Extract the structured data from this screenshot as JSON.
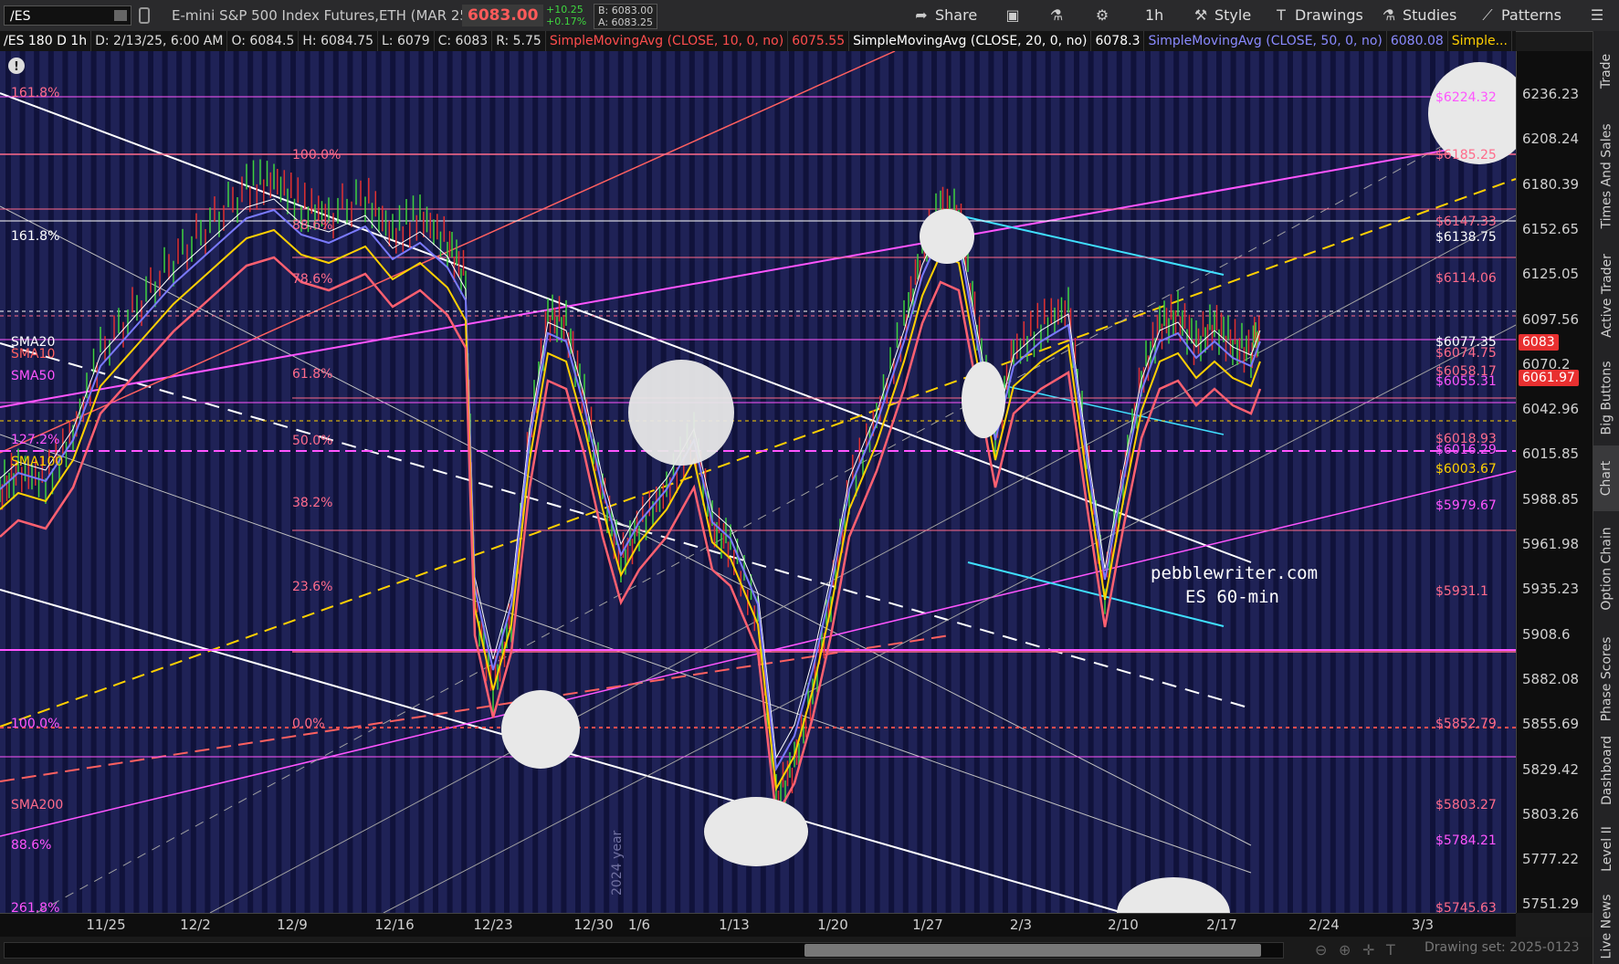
{
  "toolbar": {
    "symbol": "/ES",
    "instrument_title": "E-mini S&P 500 Index Futures,ETH (MAR 25)",
    "last_price": "6083.00",
    "net_change": "+10.25",
    "pct_change": "+0.17%",
    "bid": "B: 6083.00",
    "ask": "A: 6083.25",
    "share_label": "Share",
    "timeframe_label": "1h",
    "style_label": "Style",
    "drawings_label": "Drawings",
    "studies_label": "Studies",
    "patterns_label": "Patterns"
  },
  "infobar": {
    "symbol_period": "/ES 180 D 1h",
    "date": "D: 2/13/25, 6:00 AM",
    "open": "O: 6084.5",
    "high": "H: 6084.75",
    "low": "L: 6079",
    "close": "C: 6083",
    "range": "R: 5.75",
    "sma10_label": "SimpleMovingAvg (CLOSE, 10, 0, no)",
    "sma10_value": "6075.55",
    "sma20_label": "SimpleMovingAvg (CLOSE, 20, 0, no)",
    "sma20_value": "6078.3",
    "sma50_label": "SimpleMovingAvg (CLOSE, 50, 0, no)",
    "sma50_value": "6080.08",
    "more_label": "Simple..."
  },
  "price_axis": {
    "ticks": [
      "6236.23",
      "6208.24",
      "6180.39",
      "6152.65",
      "6125.05",
      "6097.56",
      "6070.2",
      "6042.96",
      "6015.85",
      "5988.85",
      "5961.98",
      "5935.23",
      "5908.6",
      "5882.08",
      "5855.69",
      "5829.42",
      "5803.26",
      "5777.22",
      "5751.29"
    ],
    "last_tag": "6083",
    "sma_tag": "6061.97"
  },
  "date_axis": {
    "ticks": [
      "11/25",
      "12/2",
      "12/9",
      "12/16",
      "12/23",
      "12/30",
      "1/6",
      "1/13",
      "1/20",
      "1/27",
      "2/3",
      "2/10",
      "2/17",
      "2/24",
      "3/3"
    ]
  },
  "fib_left": {
    "fib_1618_top": "161.8%",
    "fib_1618": "161.8%",
    "fib_100": "100.0%",
    "fib_886": "88.6%",
    "fib_786": "78.6%",
    "fib_618": "61.8%",
    "fib_50": "50.0%",
    "fib_382": "38.2%",
    "fib_236": "23.6%",
    "fib_0": "0.0%",
    "fib_127": "127.2%",
    "fib_100b": "100.0%",
    "fib_886b": "88.6%",
    "fib_2618": "261.8%"
  },
  "sma_labels": {
    "sma20": "SMA20",
    "sma10": "SMA10",
    "sma50": "SMA50",
    "sma100": "SMA100",
    "sma200": "SMA200"
  },
  "price_levels": {
    "l6224": "$6224.32",
    "l6185": "$6185.25",
    "l6147": "$6147.33",
    "l6138": "$6138.75",
    "l6114": "$6114.06",
    "l6077": "$6077.35",
    "l6074": "$6074.75",
    "l6058": "$6058.17",
    "l6055": "$6055.31",
    "l6018": "$6018.93",
    "l6016": "$6016.29",
    "l6003": "$6003.67",
    "l5979": "$5979.67",
    "l5931": "$5931.1",
    "l5852": "$5852.79",
    "l5803": "$5803.27",
    "l5784": "$5784.21",
    "l5745": "$5745.63"
  },
  "annotation": {
    "site": "pebblewriter.com",
    "label": "ES 60-min"
  },
  "watermark": "2024 year",
  "right_tabs": [
    "Trade",
    "Times And Sales",
    "Active Trader",
    "Big Buttons",
    "Chart",
    "Option Chain",
    "Phase Scores",
    "Dashboard",
    "Level II",
    "Live News"
  ],
  "active_tab": "Chart",
  "bottombar": {
    "drawing_set": "Drawing set: 2025-0123"
  },
  "colors": {
    "chart_bg": "#1f2256",
    "stripe": "#10123a",
    "fib_line": "#ff6b8b",
    "magenta": "#ff55ff",
    "sma10": "#ff7070",
    "sma20": "#ffffff",
    "sma50": "#7a7aff",
    "sma100": "#ffd000",
    "cyan": "#40e0ff",
    "price_tag_red": "#e83030"
  }
}
